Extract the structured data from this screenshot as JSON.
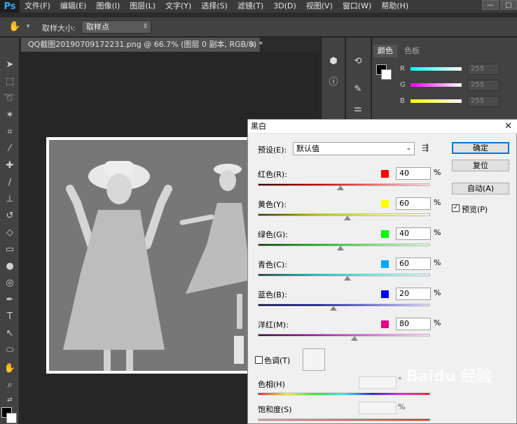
{
  "app": {
    "logo": "Ps"
  },
  "menu": [
    "文件(F)",
    "编辑(E)",
    "图像(I)",
    "图层(L)",
    "文字(Y)",
    "选择(S)",
    "滤镜(T)",
    "3D(D)",
    "视图(V)",
    "窗口(W)",
    "帮助(H)"
  ],
  "window_controls": {
    "minimize": "—",
    "restore": "□"
  },
  "options_bar": {
    "sample_size_label": "取样大小:",
    "sample_size_value": "取样点"
  },
  "document": {
    "tab_title": "QQ截图20190709172231.png @ 66.7% (图层 0 副本, RGB/8) *",
    "close": "×"
  },
  "color_panel": {
    "tabs": [
      "颜色",
      "色板"
    ],
    "sliders": [
      {
        "label": "R",
        "value": "255"
      },
      {
        "label": "G",
        "value": "255"
      },
      {
        "label": "B",
        "value": "255"
      }
    ]
  },
  "dialog": {
    "title": "黑白",
    "preset_label": "预设(E):",
    "preset_value": "默认值",
    "channels": [
      {
        "label": "红色(R):",
        "value": "40",
        "swatch": "#ff0000",
        "position": 0.48
      },
      {
        "label": "黄色(Y):",
        "value": "60",
        "swatch": "#ffff00",
        "position": 0.52
      },
      {
        "label": "绿色(G):",
        "value": "40",
        "swatch": "#00ff00",
        "position": 0.48
      },
      {
        "label": "青色(C):",
        "value": "60",
        "swatch": "#00aaff",
        "position": 0.52
      },
      {
        "label": "蓝色(B):",
        "value": "20",
        "swatch": "#0000ff",
        "position": 0.44
      },
      {
        "label": "洋红(M):",
        "value": "80",
        "swatch": "#e6008a",
        "position": 0.56
      }
    ],
    "percent": "%",
    "buttons": {
      "ok": "确定",
      "reset": "复位",
      "auto": "自动(A)"
    },
    "preview_label": "预览(P)",
    "tint_label": "色调(T)",
    "hue_label": "色相(H)",
    "hue_unit": "°",
    "saturation_label": "饱和度(S)",
    "saturation_unit": "%"
  },
  "watermark": "Baidu 经验"
}
